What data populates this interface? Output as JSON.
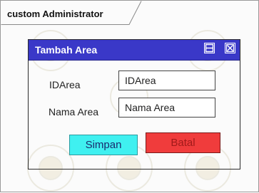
{
  "frame": {
    "title": "custom Administrator"
  },
  "dialog": {
    "title": "Tambah Area",
    "buttons": {
      "maximize_icon": "maximize-icon",
      "close_icon": "close-icon"
    },
    "fields": [
      {
        "label": "IDArea",
        "value": "IDArea"
      },
      {
        "label": "Nama Area",
        "value": "Nama Area"
      }
    ],
    "actions": {
      "save_label": "Simpan",
      "cancel_label": "Batal"
    }
  },
  "colors": {
    "titlebar": "#3a38c8",
    "save_button": "#3ff0f0",
    "cancel_button": "#f03c3c"
  }
}
